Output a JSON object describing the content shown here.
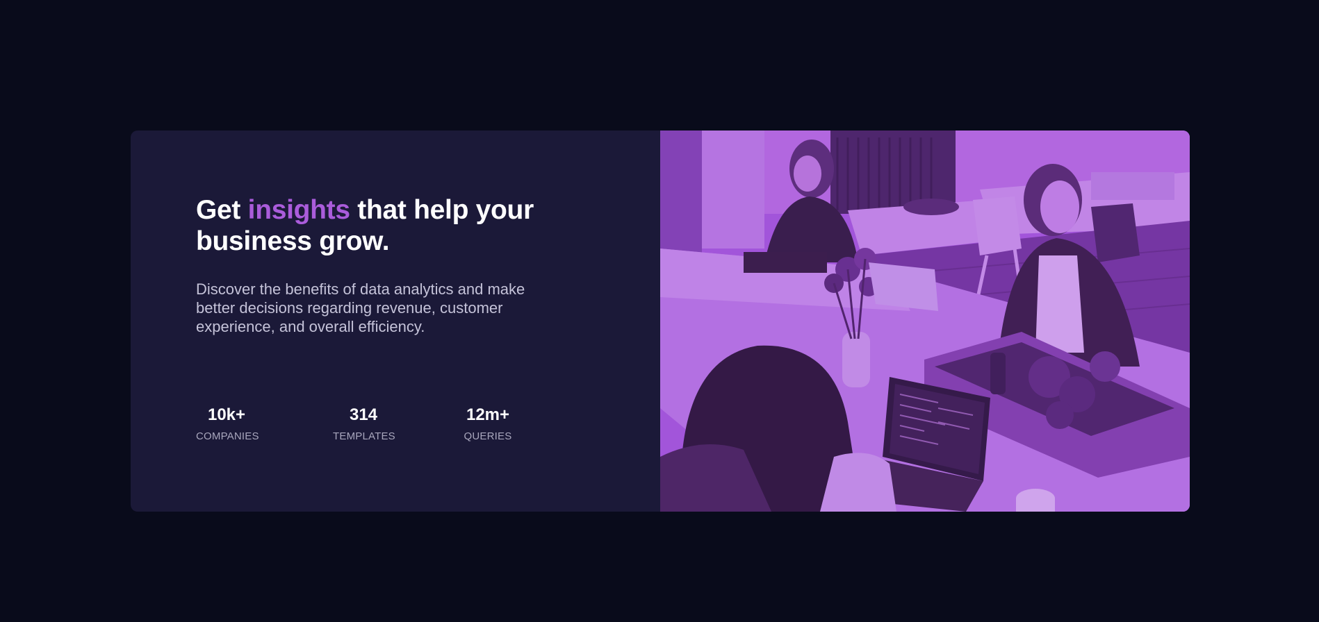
{
  "hero": {
    "headline_before": "Get ",
    "headline_accent": "insights",
    "headline_after": " that help your business grow.",
    "description": "Discover the benefits of data analytics and make better decisions regarding revenue, customer experience, and overall efficiency."
  },
  "stats": [
    {
      "value": "10k+",
      "label": "COMPANIES"
    },
    {
      "value": "314",
      "label": "TEMPLATES"
    },
    {
      "value": "12m+",
      "label": "QUERIES"
    }
  ],
  "image": {
    "subject": "people-working-in-office-photo",
    "tint_color": "#aa5cdb"
  },
  "colors": {
    "page_background": "#090b1b",
    "card_background": "#1b1938",
    "accent": "#aa5cdb",
    "heading": "#ffffff",
    "body_text": "#c5c3d9",
    "stat_label": "#a9a7bd"
  }
}
